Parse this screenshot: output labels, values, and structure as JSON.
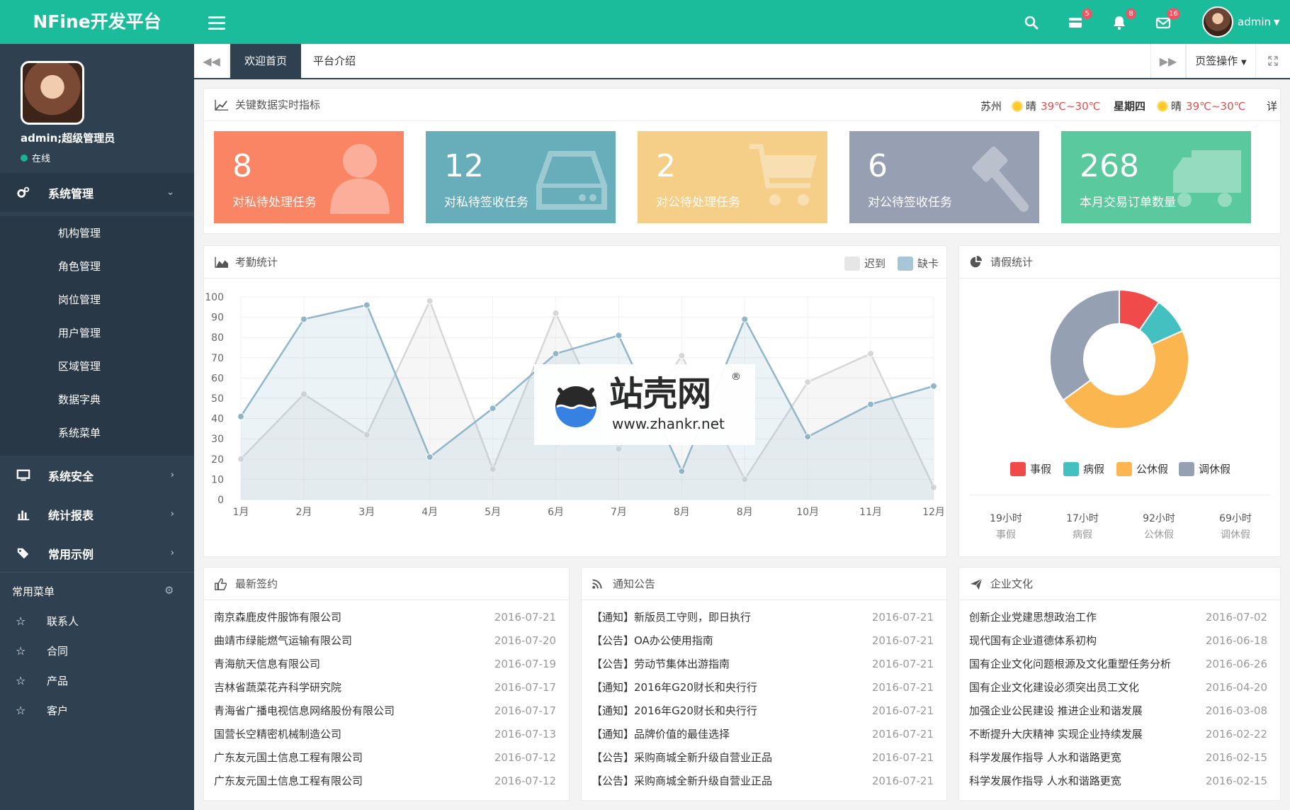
{
  "app": {
    "title": "NFine开发平台",
    "user": "admin"
  },
  "topbar": {
    "badges": {
      "messages": "5",
      "notifications": "8",
      "mail": "16"
    },
    "accent": "#1abc9c"
  },
  "sidebar": {
    "profile": {
      "name": "admin;超级管理员",
      "status": "在线"
    },
    "groups": [
      {
        "label": "系统管理",
        "icon": "gears-icon"
      },
      {
        "label": "系统安全",
        "icon": "monitor-icon"
      },
      {
        "label": "统计报表",
        "icon": "bar-chart-icon"
      },
      {
        "label": "常用示例",
        "icon": "tags-icon"
      }
    ],
    "submenu": [
      "机构管理",
      "角色管理",
      "岗位管理",
      "用户管理",
      "区域管理",
      "数据字典",
      "系统菜单"
    ],
    "quick": {
      "title": "常用菜单",
      "items": [
        "联系人",
        "合同",
        "产品",
        "客户"
      ]
    }
  },
  "tabs": {
    "items": [
      "欢迎首页",
      "平台介绍"
    ],
    "ops": "页签操作"
  },
  "kpi_panel": {
    "title": "关键数据实时指标",
    "weather": {
      "city": "苏州",
      "cond1": "晴",
      "temp1": "39℃~30℃",
      "day": "星期四",
      "cond2": "晴",
      "temp2": "39℃~30℃",
      "more": "详"
    },
    "cards": [
      {
        "value": "8",
        "label": "对私待处理任务",
        "color": "#fa8564"
      },
      {
        "value": "12",
        "label": "对私待签收任务",
        "color": "#68aeba"
      },
      {
        "value": "2",
        "label": "对公待处理任务",
        "color": "#f5ce88"
      },
      {
        "value": "6",
        "label": "对公待签收任务",
        "color": "#979fb2"
      },
      {
        "value": "268",
        "label": "本月交易订单数量",
        "color": "#5ac99d"
      }
    ]
  },
  "attendance": {
    "title": "考勤统计",
    "legend": [
      "迟到",
      "缺卡"
    ]
  },
  "leave": {
    "title": "请假统计",
    "legend": [
      "事假",
      "病假",
      "公休假",
      "调休假"
    ],
    "stats": [
      {
        "value": "19小时",
        "label": "事假"
      },
      {
        "value": "17小时",
        "label": "病假"
      },
      {
        "value": "92小时",
        "label": "公休假"
      },
      {
        "value": "69小时",
        "label": "调休假"
      }
    ]
  },
  "chart_data": [
    {
      "type": "area",
      "title": "",
      "categories": [
        "1月",
        "2月",
        "3月",
        "4月",
        "5月",
        "6月",
        "7月",
        "8月",
        "8月",
        "10月",
        "11月",
        "12月"
      ],
      "ylim": [
        0,
        100
      ],
      "yticks": [
        "0",
        "10",
        "20",
        "30",
        "40",
        "50",
        "60",
        "70",
        "80",
        "90",
        "100"
      ],
      "grid": true,
      "legend_position": "top-right",
      "series": [
        {
          "name": "迟到",
          "values": [
            20,
            52,
            32,
            98,
            15,
            92,
            25,
            71,
            10,
            58,
            72,
            6
          ],
          "color": "#d7d7d7"
        },
        {
          "name": "缺卡",
          "values": [
            41,
            89,
            96,
            21,
            45,
            72,
            81,
            14,
            89,
            31,
            47,
            56
          ],
          "color": "#8fb6c9"
        }
      ]
    },
    {
      "type": "pie",
      "title": "",
      "categories": [
        "事假",
        "病假",
        "公休假",
        "调休假"
      ],
      "values": [
        19,
        17,
        92,
        69
      ],
      "colors": [
        "#f14a4a",
        "#44c0c1",
        "#fcb64f",
        "#95a0b2"
      ],
      "donut": true
    }
  ],
  "lists": [
    {
      "title": "最新签约",
      "icon": "thumbs-up-icon",
      "rows": [
        {
          "text": "南京森鹿皮件服饰有限公司",
          "date": "2016-07-21"
        },
        {
          "text": "曲靖市绿能燃气运输有限公司",
          "date": "2016-07-20"
        },
        {
          "text": "青海航天信息有限公司",
          "date": "2016-07-19"
        },
        {
          "text": "吉林省蔬菜花卉科学研究院",
          "date": "2016-07-17"
        },
        {
          "text": "青海省广播电视信息网络股份有限公司",
          "date": "2016-07-17"
        },
        {
          "text": "国营长空精密机械制造公司",
          "date": "2016-07-13"
        },
        {
          "text": "广东友元国土信息工程有限公司",
          "date": "2016-07-12"
        },
        {
          "text": "广东友元国土信息工程有限公司",
          "date": "2016-07-12"
        }
      ]
    },
    {
      "title": "通知公告",
      "icon": "rss-icon",
      "rows": [
        {
          "text": "【通知】新版员工守则，即日执行",
          "date": "2016-07-21"
        },
        {
          "text": "【公告】OA办公使用指南",
          "date": "2016-07-21"
        },
        {
          "text": "【公告】劳动节集体出游指南",
          "date": "2016-07-21"
        },
        {
          "text": "【通知】2016年G20财长和央行行",
          "date": "2016-07-21"
        },
        {
          "text": "【通知】2016年G20财长和央行行",
          "date": "2016-07-21"
        },
        {
          "text": "【通知】品牌价值的最佳选择",
          "date": "2016-07-21"
        },
        {
          "text": "【公告】采购商城全新升级自营业正品",
          "date": "2016-07-21"
        },
        {
          "text": "【公告】采购商城全新升级自营业正品",
          "date": "2016-07-21"
        }
      ]
    },
    {
      "title": "企业文化",
      "icon": "paper-plane-icon",
      "rows": [
        {
          "text": "创新企业党建思想政治工作",
          "date": "2016-07-02"
        },
        {
          "text": "现代国有企业道德体系初构",
          "date": "2016-06-18"
        },
        {
          "text": "国有企业文化问题根源及文化重塑任务分析",
          "date": "2016-06-26"
        },
        {
          "text": "国有企业文化建设必须突出员工文化",
          "date": "2016-04-20"
        },
        {
          "text": "加强企业公民建设 推进企业和谐发展",
          "date": "2016-03-08"
        },
        {
          "text": "不断提升大庆精神 实现企业持续发展",
          "date": "2016-02-22"
        },
        {
          "text": "科学发展作指导 人水和谐路更宽",
          "date": "2016-02-15"
        },
        {
          "text": "科学发展作指导 人水和谐路更宽",
          "date": "2016-02-15"
        }
      ]
    }
  ],
  "watermark": {
    "brand": "站壳网",
    "url": "www.zhankr.net"
  }
}
